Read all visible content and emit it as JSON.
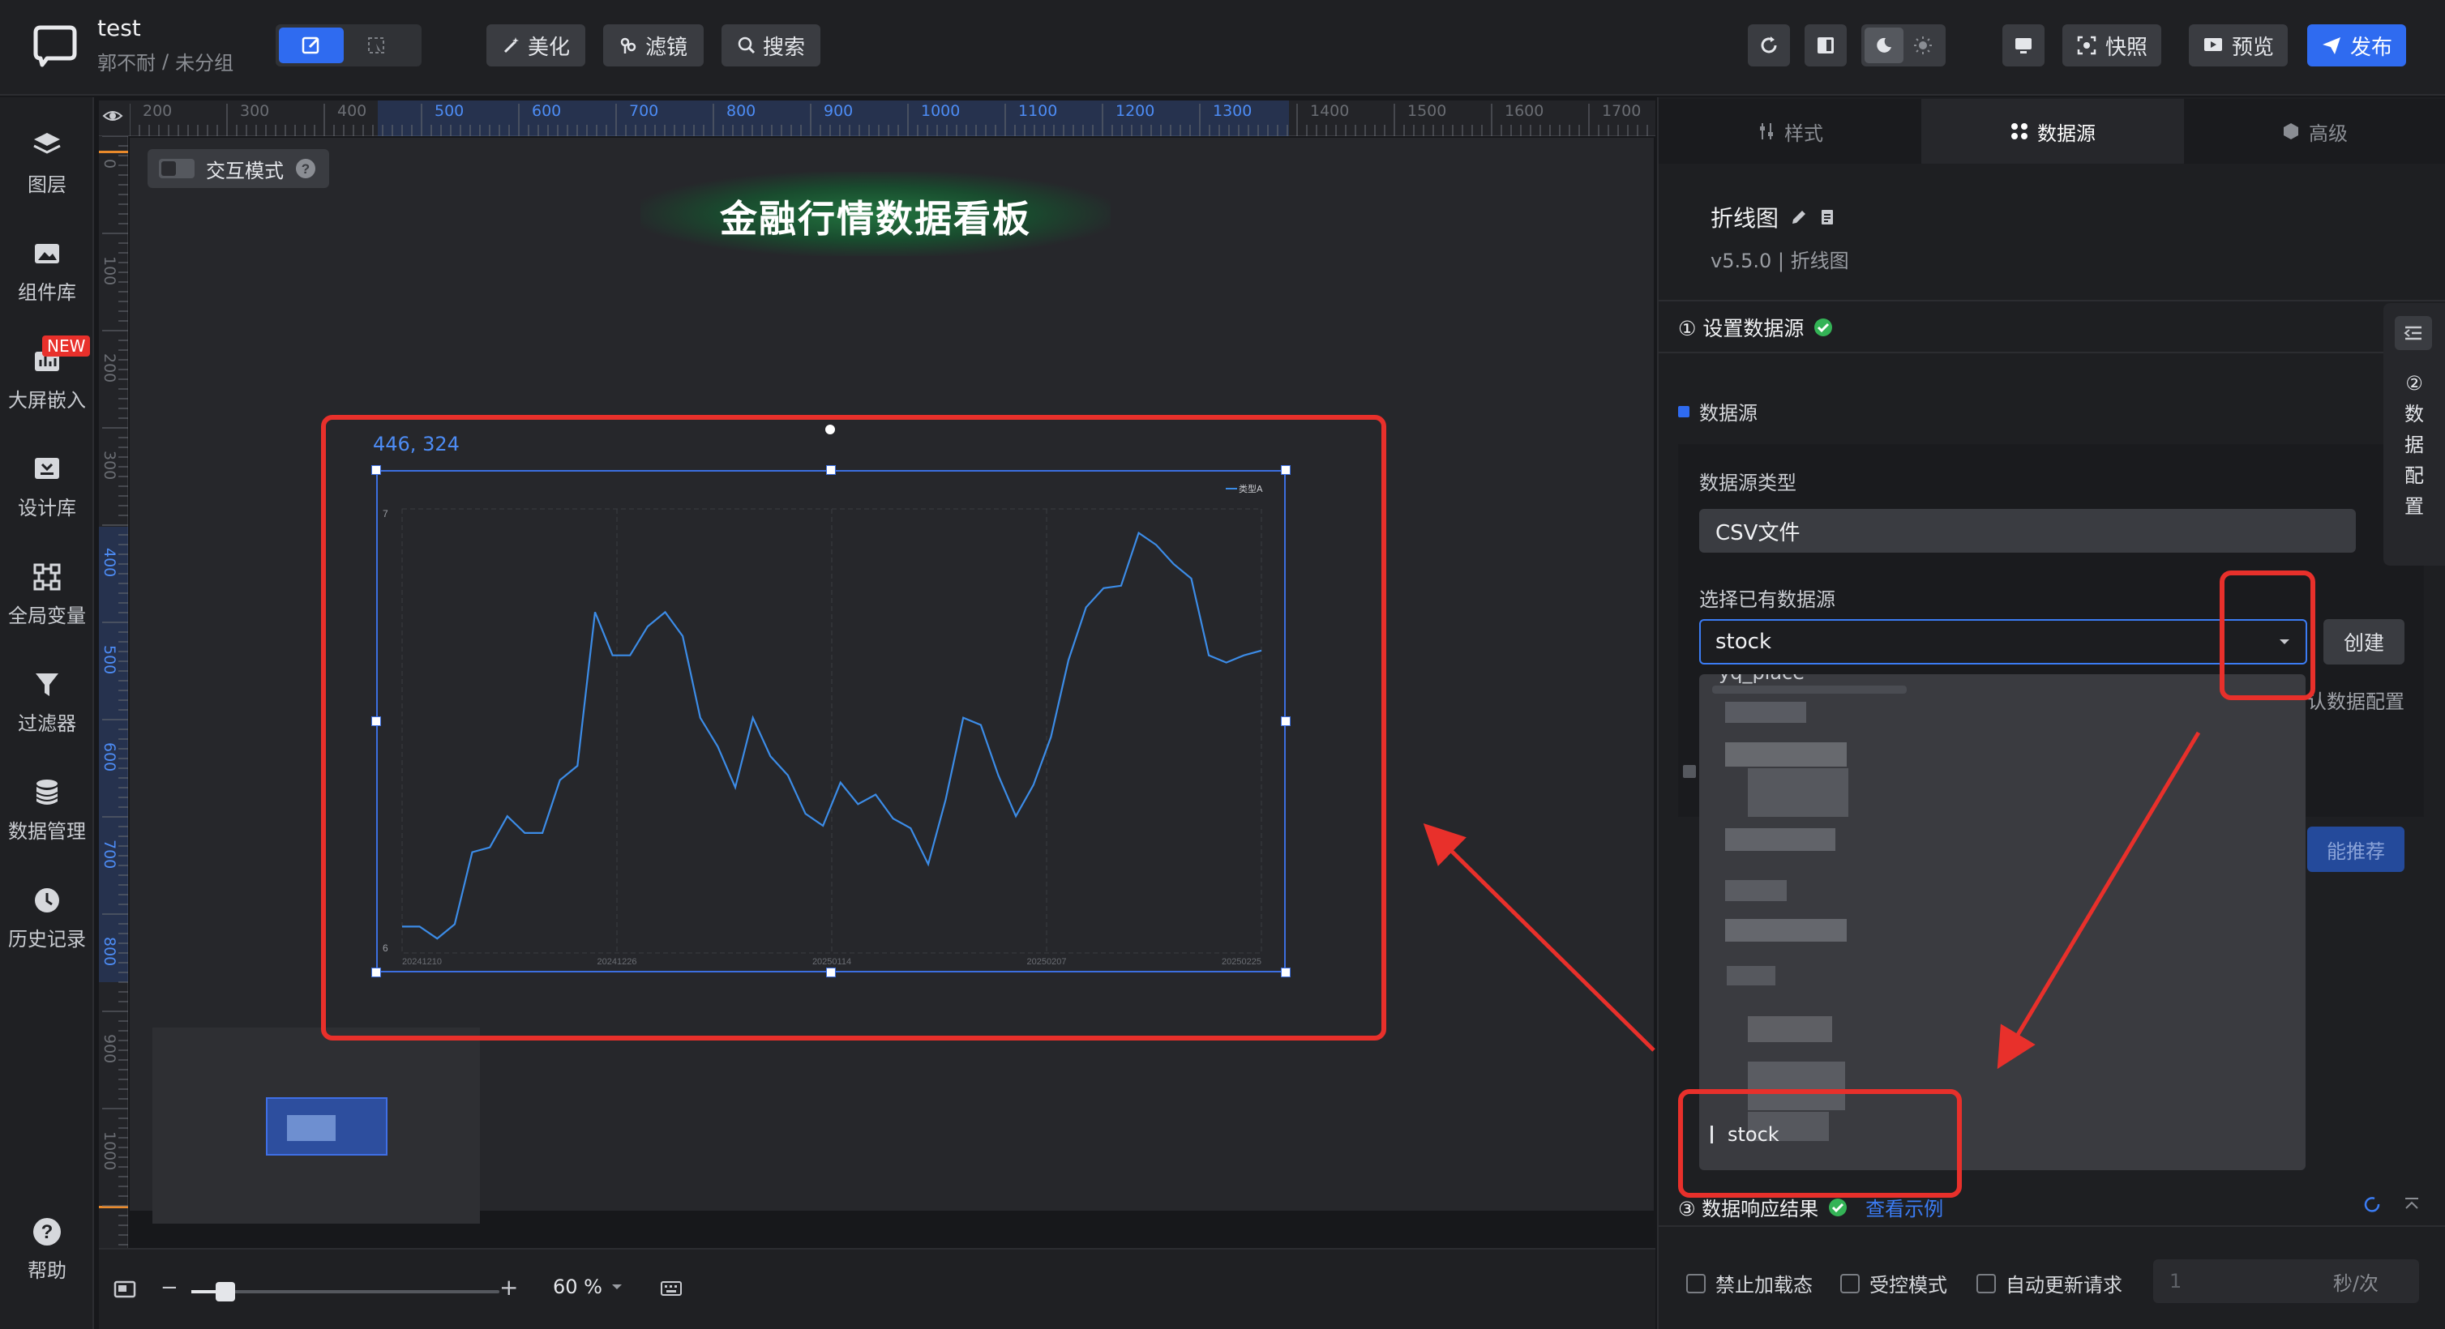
{
  "project": {
    "title": "test",
    "owner": "郭不耐",
    "separator": "/",
    "group": "未分组"
  },
  "toolbar": {
    "beautify": "美化",
    "filter": "滤镜",
    "search": "搜索",
    "snapshot": "快照",
    "preview": "预览",
    "publish": "发布"
  },
  "sidebar": {
    "items": [
      {
        "label": "图层",
        "icon": "layers-icon"
      },
      {
        "label": "组件库",
        "icon": "image-gallery-icon"
      },
      {
        "label": "大屏嵌入",
        "icon": "embed-chart-icon",
        "badge": "NEW"
      },
      {
        "label": "设计库",
        "icon": "design-library-icon"
      },
      {
        "label": "全局变量",
        "icon": "variables-icon"
      },
      {
        "label": "过滤器",
        "icon": "funnel-icon"
      },
      {
        "label": "数据管理",
        "icon": "database-icon"
      },
      {
        "label": "历史记录",
        "icon": "clock-icon"
      }
    ],
    "help": "帮助"
  },
  "ruler": {
    "ticks": [
      "200",
      "300",
      "400",
      "500",
      "600",
      "700",
      "800",
      "900",
      "1000",
      "1100",
      "1200",
      "1300",
      "1400",
      "1500",
      "1600",
      "1700"
    ],
    "vticks": [
      "0",
      "100",
      "200",
      "300",
      "400",
      "500",
      "600",
      "700",
      "800",
      "900",
      "1000"
    ]
  },
  "canvas": {
    "interact_mode": "交互模式",
    "dashboard_title": "金融行情数据看板",
    "coords": "446, 324"
  },
  "chart_data": {
    "type": "line",
    "series": [
      {
        "name": "类型A",
        "values": [
          1.1,
          1.1,
          0.6,
          1.2,
          4.2,
          4.4,
          5.7,
          5,
          5,
          7.2,
          7.8,
          14.2,
          12.4,
          12.4,
          13.6,
          14.2,
          13.2,
          9.8,
          8.6,
          6.9,
          9.8,
          8.2,
          7.4,
          5.8,
          5.3,
          7.1,
          6.2,
          6.6,
          5.6,
          5.2,
          3.7,
          6.4,
          9.8,
          9.5,
          7.4,
          5.7,
          7,
          9,
          12.2,
          14.4,
          15.2,
          15.3,
          17.5,
          17,
          16.2,
          15.6,
          12.4,
          12.1,
          12.4,
          12.6
        ]
      }
    ],
    "x_labels": [
      "20241210",
      "20241226",
      "20250114",
      "20250207",
      "20250225"
    ],
    "y_ticks": [
      "7",
      "6"
    ],
    "grid": true,
    "legend": "top-right",
    "color": "#3c8ce7"
  },
  "zoom": {
    "minus": "−",
    "plus": "+",
    "value": "60 %",
    "level": 0.11
  },
  "panel": {
    "tabs": [
      "样式",
      "数据源",
      "高级"
    ],
    "component_name": "折线图",
    "version": "v5.5.0 | 折线图",
    "step1": "① 设置数据源",
    "section": "数据源",
    "type_label": "数据源类型",
    "type_value": "CSV文件",
    "select_label": "选择已有数据源",
    "select_value": "stock",
    "create": "创建",
    "default_config": "认数据配置",
    "smart": "能推荐",
    "partial_item": "yq_place",
    "dropdown_selected": "stock",
    "side_tab": [
      "②",
      "数",
      "据",
      "配",
      "置"
    ],
    "step3": "③ 数据响应结果",
    "example": "查看示例",
    "opts": [
      "禁止加载态",
      "受控模式",
      "自动更新请求"
    ],
    "interval_value": "1",
    "interval_unit": "秒/次"
  }
}
